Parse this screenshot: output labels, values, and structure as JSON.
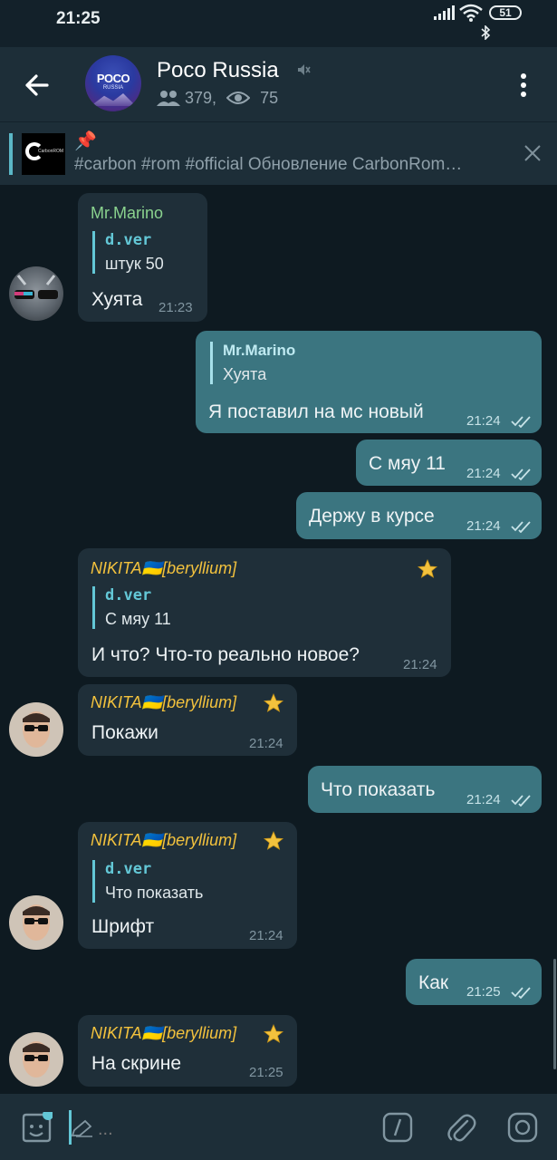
{
  "status": {
    "time": "21:25",
    "battery": "51"
  },
  "header": {
    "title": "Poco Russia",
    "avatar_text": "POCO",
    "avatar_sub": "RUSSIA",
    "members": "379,",
    "online": "75"
  },
  "pinned": {
    "thumb_text": "CarbonROM",
    "text": "#carbon #rom #official  Обновление CarbonRom…"
  },
  "messages": [
    {
      "sender": "Mr.Marino",
      "quote_name": "d.ver",
      "quote_text": "штук 50",
      "text": "Хуята",
      "time": "21:23"
    },
    {
      "quote_name": "Mr.Marino",
      "quote_text": "Хуята",
      "text": "Я поставил на мс новый",
      "time": "21:24"
    },
    {
      "text": "С мяу 11",
      "time": "21:24"
    },
    {
      "text": "Держу в курсе",
      "time": "21:24"
    },
    {
      "sender": "NIKITA🇺🇦[beryllium]",
      "quote_name": "d.ver",
      "quote_text": "С мяу 11",
      "text": "И что? Что-то реально новое?",
      "time": "21:24"
    },
    {
      "sender": "NIKITA🇺🇦[beryllium]",
      "text": "Покажи",
      "time": "21:24"
    },
    {
      "text": "Что показать",
      "time": "21:24"
    },
    {
      "sender": "NIKITA🇺🇦[beryllium]",
      "quote_name": "d.ver",
      "quote_text": "Что показать",
      "text": "Шрифт",
      "time": "21:24"
    },
    {
      "text": "Как",
      "time": "21:25"
    },
    {
      "sender": "NIKITA🇺🇦[beryllium]",
      "text": "На скрине",
      "time": "21:25"
    }
  ],
  "input": {
    "placeholder": "..."
  },
  "colors": {
    "accent": "#63c7d6",
    "out_bubble": "#3b7580",
    "in_bubble": "#1f2f39",
    "gold": "#f3c23d",
    "green": "#8ad28e"
  }
}
